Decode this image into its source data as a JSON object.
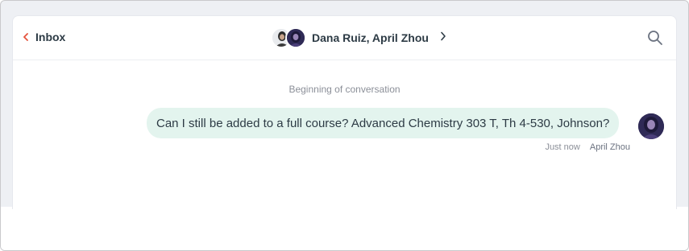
{
  "header": {
    "back_label": "Inbox",
    "title": "Dana Ruiz, April Zhou",
    "icons": [
      "chevron-left-icon",
      "chevron-right-icon",
      "search-icon"
    ],
    "accent_color": "#e5533d"
  },
  "conversation": {
    "beginning_label": "Beginning of conversation",
    "messages": [
      {
        "text": "Can I still be added to a full course? Advanced Chemistry 303 T, Th 4-530, Johnson?",
        "timestamp": "Just now",
        "author": "April Zhou",
        "bubble_color": "#e3f4ee"
      }
    ]
  }
}
